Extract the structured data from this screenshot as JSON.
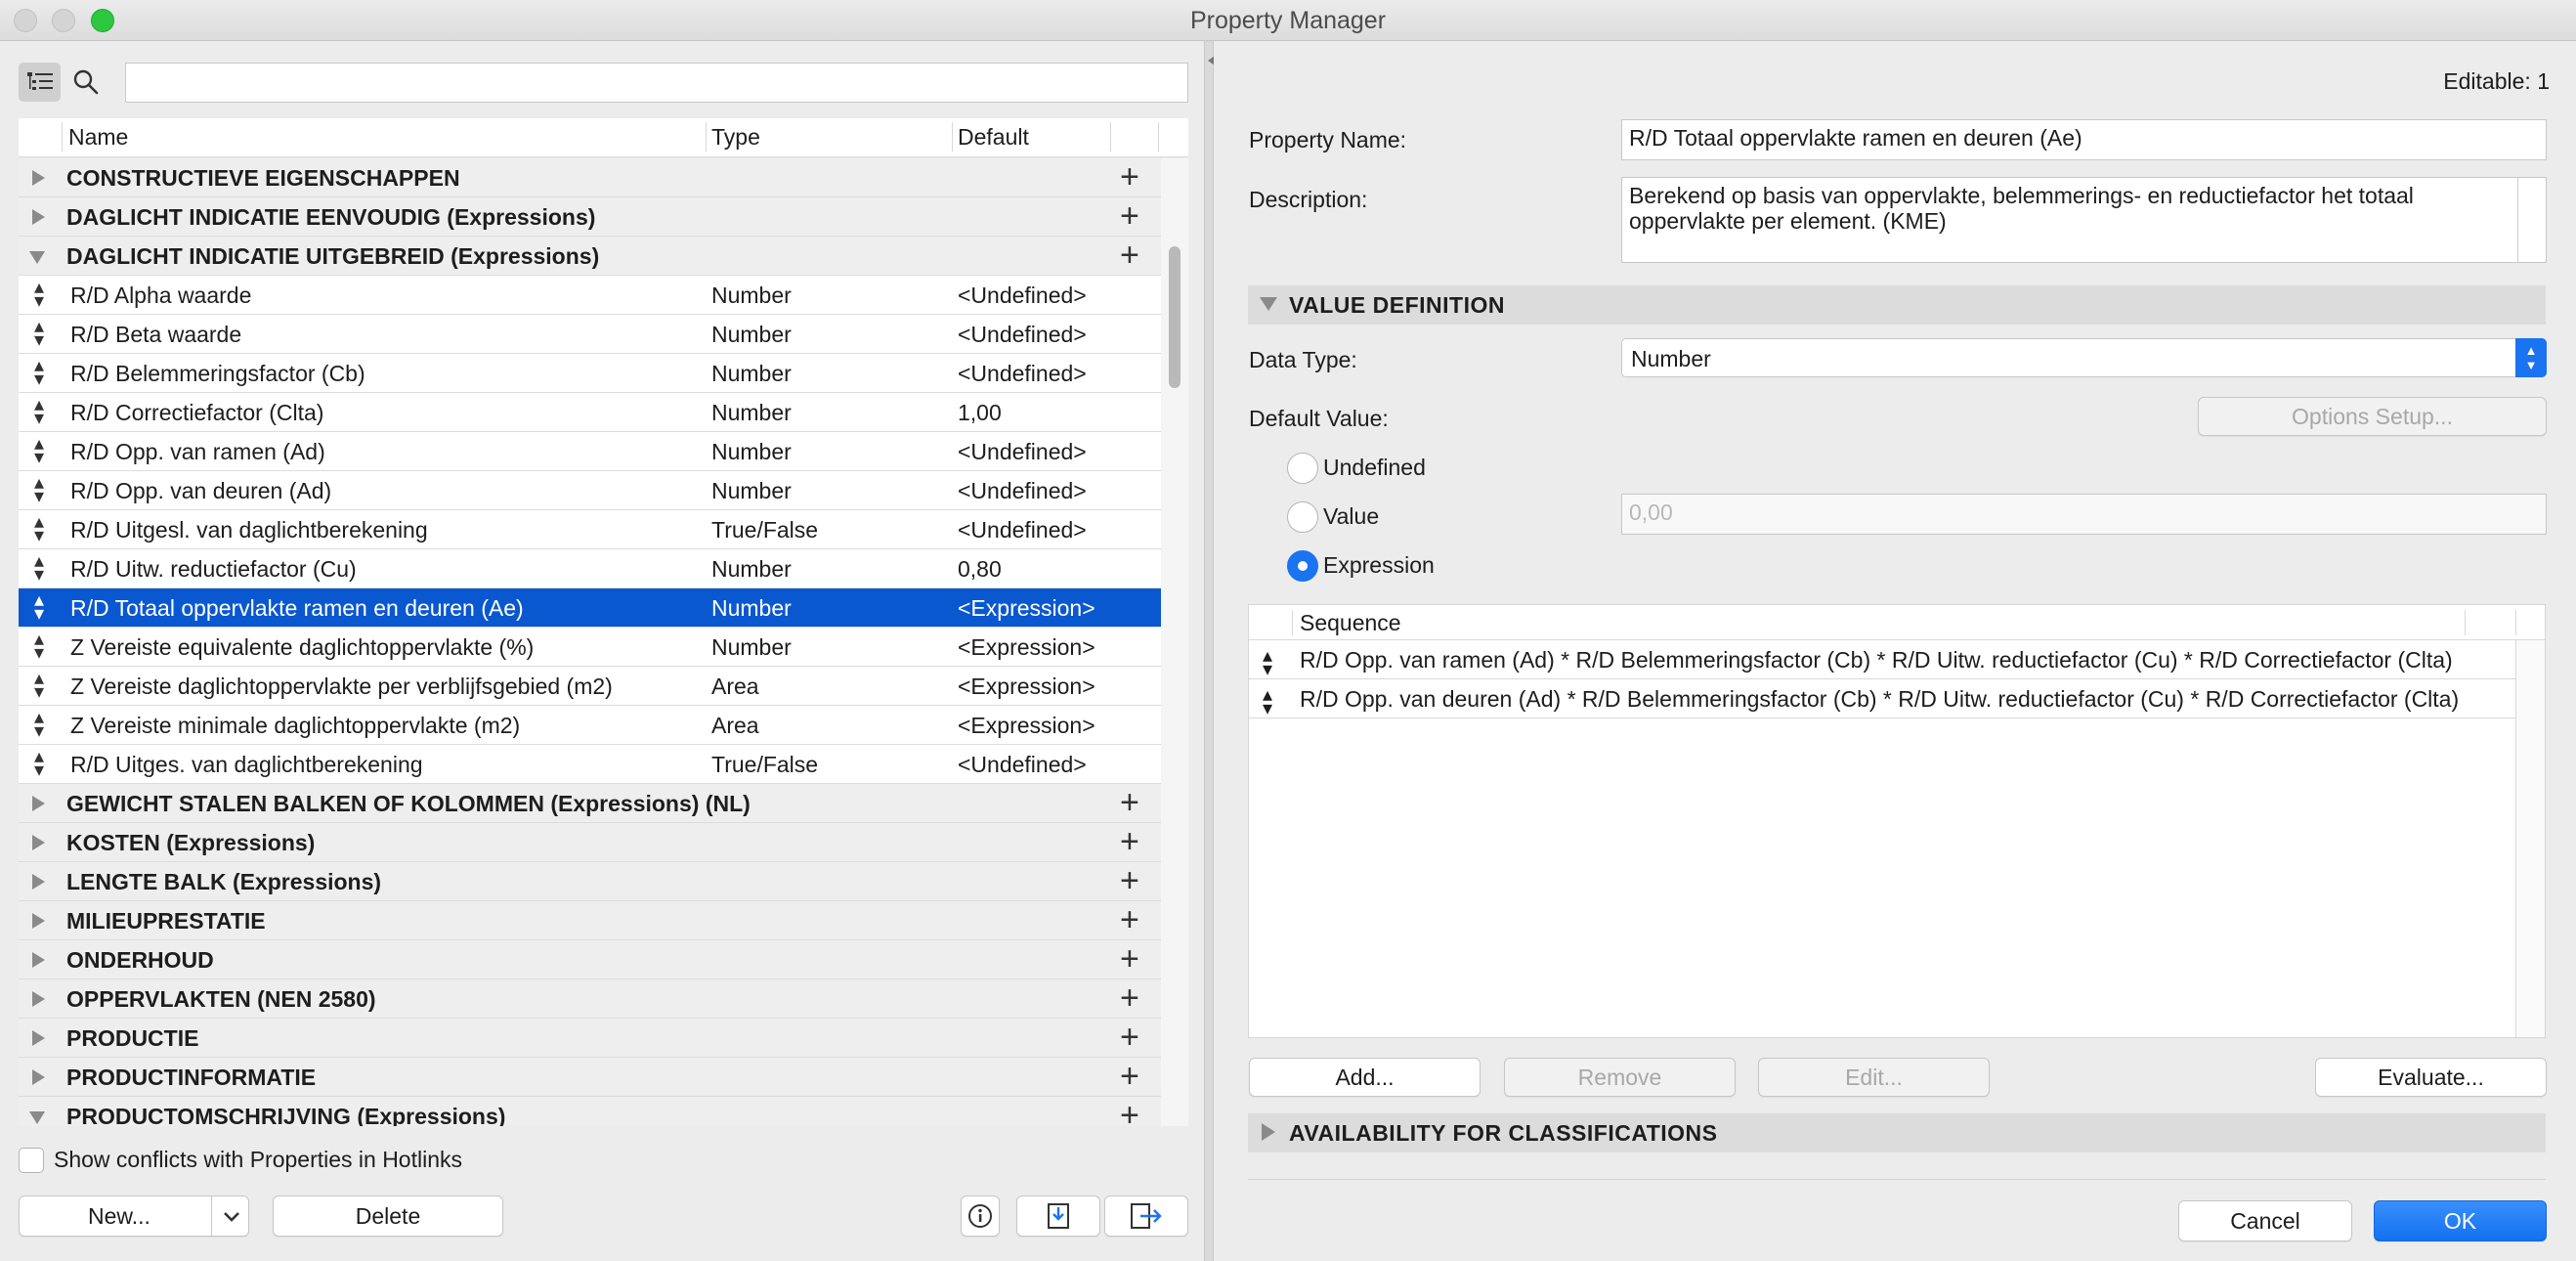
{
  "window": {
    "title": "Property Manager"
  },
  "left": {
    "columns": {
      "name": "Name",
      "type": "Type",
      "default": "Default"
    },
    "rows": [
      {
        "kind": "group",
        "label": "CONSTRUCTIEVE EIGENSCHAPPEN",
        "expanded": false
      },
      {
        "kind": "group",
        "label": "DAGLICHT INDICATIE EENVOUDIG (Expressions)",
        "expanded": false
      },
      {
        "kind": "group",
        "label": "DAGLICHT INDICATIE UITGEBREID (Expressions)",
        "expanded": true
      },
      {
        "kind": "item",
        "name": "R/D Alpha waarde",
        "type": "Number",
        "default": "<Undefined>"
      },
      {
        "kind": "item",
        "name": "R/D Beta waarde",
        "type": "Number",
        "default": "<Undefined>"
      },
      {
        "kind": "item",
        "name": "R/D Belemmeringsfactor (Cb)",
        "type": "Number",
        "default": "<Undefined>"
      },
      {
        "kind": "item",
        "name": "R/D Correctiefactor (Clta)",
        "type": "Number",
        "default": "1,00"
      },
      {
        "kind": "item",
        "name": "R/D Opp. van ramen (Ad)",
        "type": "Number",
        "default": "<Undefined>"
      },
      {
        "kind": "item",
        "name": "R/D Opp. van deuren (Ad)",
        "type": "Number",
        "default": "<Undefined>"
      },
      {
        "kind": "item",
        "name": "R/D Uitgesl. van daglichtberekening",
        "type": "True/False",
        "default": "<Undefined>"
      },
      {
        "kind": "item",
        "name": "R/D Uitw. reductiefactor (Cu)",
        "type": "Number",
        "default": "0,80"
      },
      {
        "kind": "item",
        "name": "R/D Totaal oppervlakte ramen en deuren (Ae)",
        "type": "Number",
        "default": "<Expression>",
        "selected": true
      },
      {
        "kind": "item",
        "name": "Z Vereiste equivalente daglichtoppervlakte (%)",
        "type": "Number",
        "default": "<Expression>"
      },
      {
        "kind": "item",
        "name": "Z Vereiste daglichtoppervlakte per verblijfsgebied (m2)",
        "type": "Area",
        "default": "<Expression>"
      },
      {
        "kind": "item",
        "name": "Z Vereiste minimale daglichtoppervlakte (m2)",
        "type": "Area",
        "default": "<Expression>"
      },
      {
        "kind": "item",
        "name": "R/D Uitges. van daglichtberekening",
        "type": "True/False",
        "default": "<Undefined>"
      },
      {
        "kind": "group",
        "label": "GEWICHT STALEN BALKEN OF KOLOMMEN (Expressions) (NL)",
        "expanded": false
      },
      {
        "kind": "group",
        "label": "KOSTEN (Expressions)",
        "expanded": false
      },
      {
        "kind": "group",
        "label": "LENGTE BALK (Expressions)",
        "expanded": false
      },
      {
        "kind": "group",
        "label": "MILIEUPRESTATIE",
        "expanded": false
      },
      {
        "kind": "group",
        "label": "ONDERHOUD",
        "expanded": false
      },
      {
        "kind": "group",
        "label": "OPPERVLAKTEN (NEN 2580)",
        "expanded": false
      },
      {
        "kind": "group",
        "label": "PRODUCTIE",
        "expanded": false
      },
      {
        "kind": "group",
        "label": "PRODUCTINFORMATIE",
        "expanded": false
      },
      {
        "kind": "group",
        "label": "PRODUCTOMSCHRIJVING (Expressions)",
        "expanded": true
      }
    ],
    "show_conflicts_label": "Show conflicts with Properties in Hotlinks",
    "new_button": "New...",
    "delete_button": "Delete"
  },
  "right": {
    "editable": "Editable: 1",
    "property_name_label": "Property Name:",
    "property_name_value": "R/D Totaal oppervlakte ramen en deuren (Ae)",
    "description_label": "Description:",
    "description_value": "Berekend op basis van oppervlakte, belemmerings- en reductiefactor het totaal oppervlakte per element. (KME)",
    "value_definition_title": "VALUE DEFINITION",
    "data_type_label": "Data Type:",
    "data_type_value": "Number",
    "default_value_label": "Default Value:",
    "options_setup_button": "Options Setup...",
    "radio_undefined": "Undefined",
    "radio_value": "Value",
    "radio_expression": "Expression",
    "value_placeholder": "0,00",
    "sequence_header": "Sequence",
    "sequence": [
      "R/D Opp. van ramen (Ad) * R/D Belemmeringsfactor (Cb) * R/D Uitw. reductiefactor (Cu) * R/D Correctiefactor (Clta)",
      "R/D Opp. van deuren (Ad) * R/D Belemmeringsfactor (Cb) * R/D Uitw. reductiefactor (Cu) * R/D Correctiefactor (Clta)"
    ],
    "add_button": "Add...",
    "remove_button": "Remove",
    "edit_button": "Edit...",
    "evaluate_button": "Evaluate...",
    "availability_title": "AVAILABILITY FOR CLASSIFICATIONS",
    "cancel_button": "Cancel",
    "ok_button": "OK"
  },
  "colors": {
    "selection": "#0a58d0",
    "accent": "#1a73f1",
    "close_light": "#d4d4d4",
    "zoom_light": "#2bc840"
  }
}
